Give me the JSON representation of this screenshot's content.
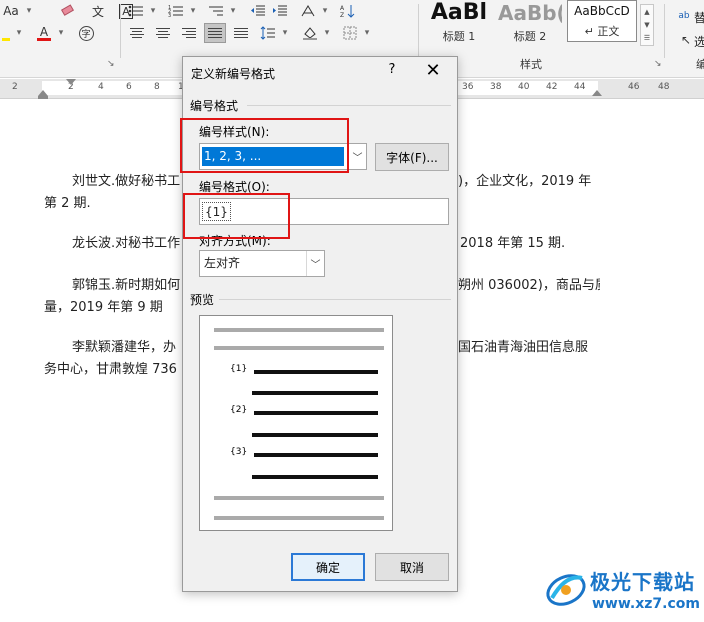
{
  "ribbon": {
    "font_case_glyph": "Aa",
    "wen_glyph": "文",
    "highlight_letter": "A",
    "font_color_letter": "A",
    "char_circle_glyph": "字",
    "styles": [
      {
        "sample": "AaBl",
        "name": "标题 1"
      },
      {
        "sample": "AaBb(",
        "name": "标题 2"
      },
      {
        "sample": "AaBbCcD",
        "name": "↵ 正文"
      }
    ],
    "styles_group_label": "样式",
    "right_labels": [
      "替",
      "选"
    ],
    "right_group_label": "编"
  },
  "ruler": {
    "numbers": [
      "2",
      "2",
      "4",
      "6",
      "8",
      "10",
      "36",
      "38",
      "40",
      "42",
      "44",
      "46",
      "48"
    ]
  },
  "document": {
    "paragraphs": [
      {
        "line1_left": "刘世文.做好秘书工",
        "line1_right": ")，企业文化，2019 年",
        "line2": "第 2 期."
      },
      {
        "line1_left": "龙长波.对秘书工作",
        "line1_right": "2018 年第 15 期.",
        "line2": ""
      },
      {
        "line1_left": "郭锦玉.新时期如何",
        "line1_right": "朔州 036002)，商品与质",
        "line2": "量，2019 年第 9 期"
      },
      {
        "line1_left": "李默颖潘建华，办",
        "line1_right": "国石油青海油田信息服",
        "line2": "务中心，甘肃敦煌 736"
      }
    ]
  },
  "dialog": {
    "title": "定义新编号格式",
    "help": "?",
    "close": "✕",
    "section_title": "编号格式",
    "style_label": "编号样式(N):",
    "style_value": "1, 2, 3, ...",
    "font_button": "字体(F)...",
    "format_label": "编号格式(O):",
    "format_value": "{1}",
    "align_label": "对齐方式(M):",
    "align_value": "左对齐",
    "preview_title": "预览",
    "preview_labels": [
      "{1}",
      "{2}",
      "{3}"
    ],
    "ok_button": "确定",
    "cancel_button": "取消"
  },
  "watermark": {
    "title": "极光下载站",
    "url": "www.xz7.com"
  },
  "colors": {
    "selection_blue": "#0078d7",
    "highlight_red": "#e01515",
    "font_color_red": "#e01515",
    "watermark_blue": "#1a75c8"
  }
}
